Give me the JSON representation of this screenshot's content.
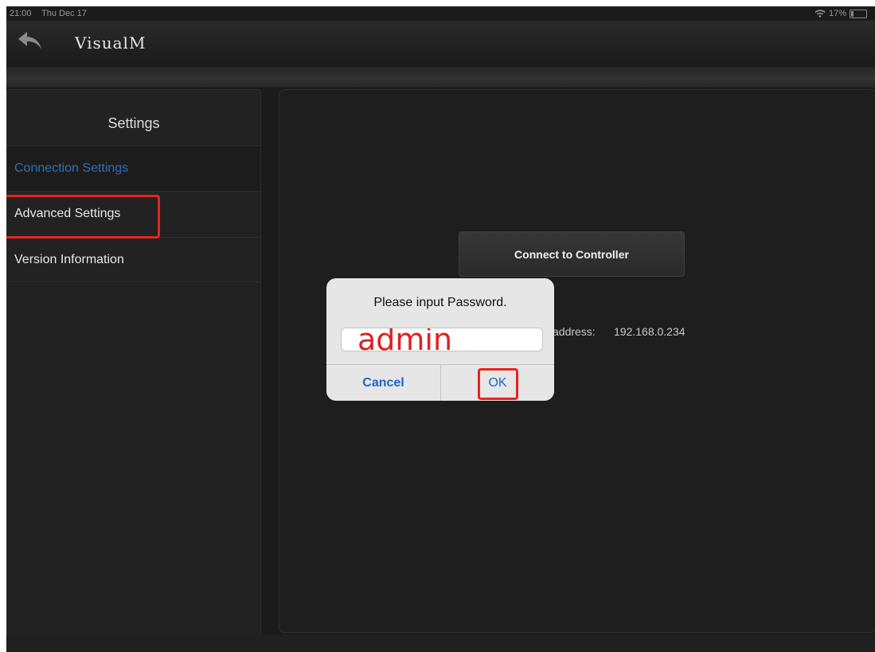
{
  "status_bar": {
    "time": "21:00",
    "date": "Thu Dec 17",
    "battery": "17%"
  },
  "header": {
    "app_title": "VisualM"
  },
  "sidebar": {
    "title": "Settings",
    "items": [
      {
        "label": "Connection Settings"
      },
      {
        "label": "Advanced Settings"
      },
      {
        "label": "Version Information"
      }
    ]
  },
  "main": {
    "connect_button": "Connect to Controller",
    "ip_label": "address:",
    "ip_value": "192.168.0.234"
  },
  "dialog": {
    "title": "Please input Password.",
    "password_value": "admin",
    "cancel_label": "Cancel",
    "ok_label": "OK"
  },
  "colors": {
    "accent_blue": "#2f6fb7",
    "highlight_red": "#e8231f",
    "dialog_button_blue": "#1f64c8"
  },
  "icons": [
    "back-arrow-icon",
    "wifi-icon",
    "battery-icon"
  ]
}
